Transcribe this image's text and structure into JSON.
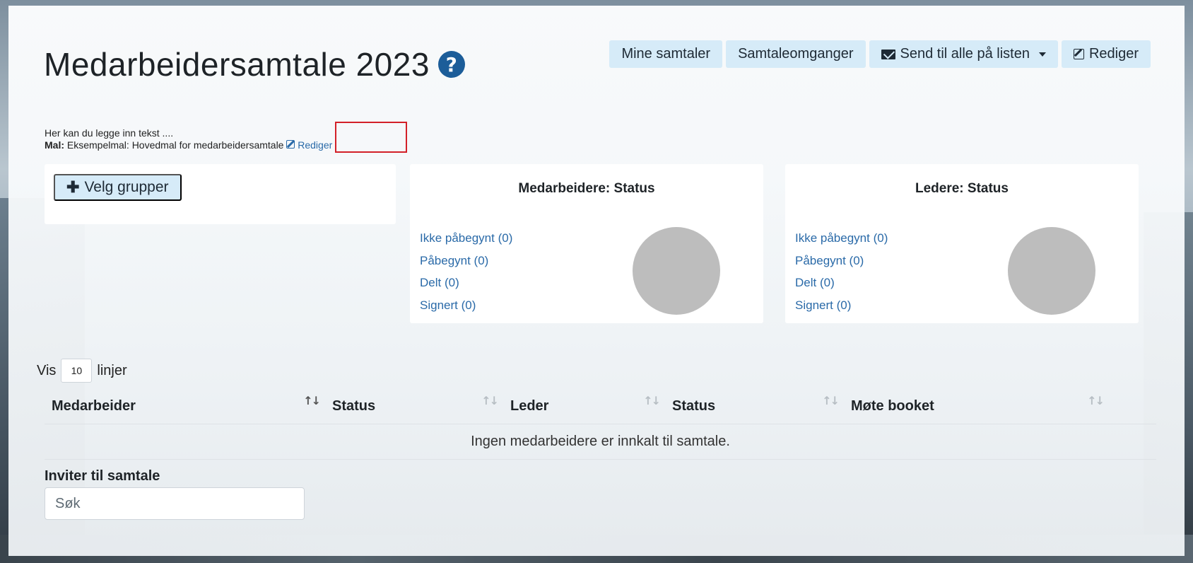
{
  "header": {
    "title": "Medarbeidersamtale 2023",
    "help_glyph": "?",
    "buttons": {
      "mine_samtaler": "Mine samtaler",
      "samtaleomganger": "Samtaleomganger",
      "send_til_alle": "Send til alle på listen",
      "rediger": "Rediger"
    }
  },
  "intro": {
    "text": "Her kan du legge inn tekst ....",
    "mal_label": "Mal:",
    "mal_value": "Eksempelmal: Hovedmal for medarbeidersamtale",
    "edit_link": "Rediger"
  },
  "groups": {
    "button_label": "Velg grupper"
  },
  "employee_status": {
    "title": "Medarbeidere: Status",
    "items": [
      "Ikke påbegynt (0)",
      "Påbegynt (0)",
      "Delt (0)",
      "Signert (0)"
    ],
    "pie_color": "#bdbdbd"
  },
  "leader_status": {
    "title": "Ledere: Status",
    "items": [
      "Ikke påbegynt (0)",
      "Påbegynt (0)",
      "Delt (0)",
      "Signert (0)"
    ],
    "pie_color": "#bdbdbd"
  },
  "table": {
    "show_prefix": "Vis",
    "show_count": "10",
    "show_suffix": "linjer",
    "columns": [
      "Medarbeider",
      "Status",
      "Leder",
      "Status",
      "Møte booket"
    ],
    "sort_glyph": "↑↓",
    "empty_message": "Ingen medarbeidere er innkalt til samtale."
  },
  "invite": {
    "label": "Inviter til samtale",
    "placeholder": "Søk"
  },
  "colors": {
    "accent_light": "#d6ebf8",
    "link": "#2a6aa8",
    "help_icon": "#1c5d99",
    "highlight": "#d32028"
  }
}
